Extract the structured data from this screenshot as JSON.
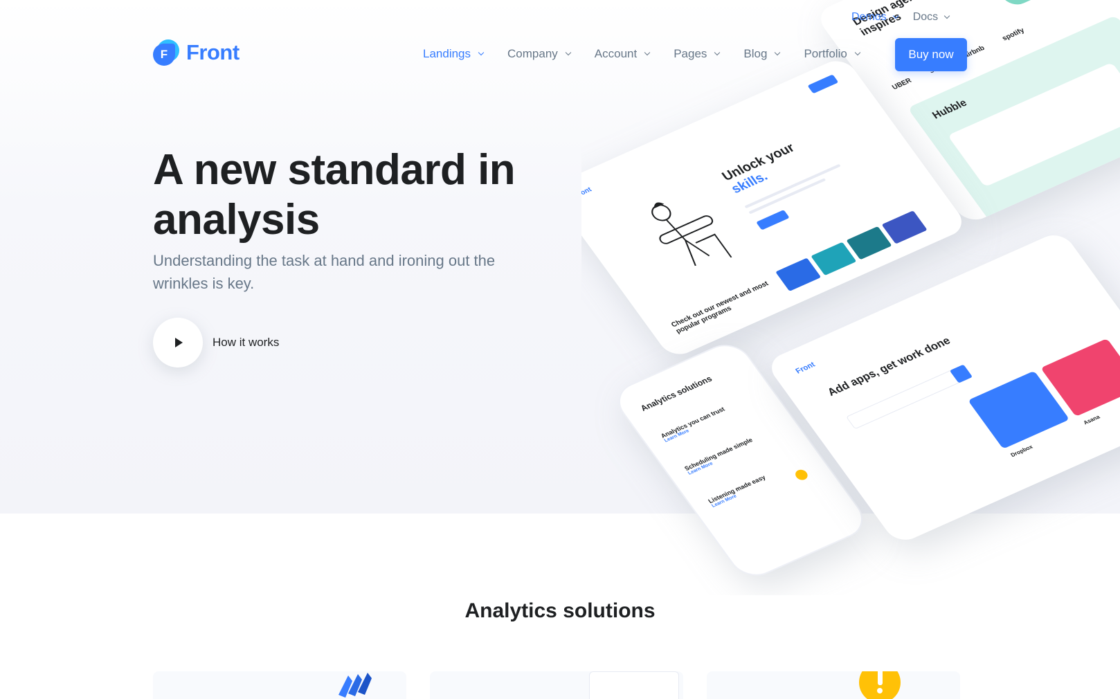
{
  "topbar": {
    "demos": "Demos",
    "docs": "Docs"
  },
  "brand": {
    "name": "Front",
    "letter": "F"
  },
  "nav": {
    "items": [
      "Landings",
      "Company",
      "Account",
      "Pages",
      "Blog",
      "Portfolio"
    ],
    "buy_label": "Buy now"
  },
  "hero": {
    "title": "A new standard in analysis",
    "subtitle": "Understanding the task at hand and ironing out the wrinkles is key.",
    "play_label": "How it works"
  },
  "mockups": {
    "tablet_headline": "Unlock your",
    "tablet_highlight": "skills.",
    "tablet_caption": "Check out our newest and most popular programs",
    "phone_title": "Analytics solutions",
    "phone_items": [
      "Analytics you can trust",
      "Scheduling made simple",
      "Listening made easy"
    ],
    "phone_link": "Learn More",
    "apps_headline": "Add apps, get work done",
    "apps_brand": "Front",
    "apps_cards": [
      "Dropbox",
      "Asana"
    ],
    "back_headline": "Design agency that inspires",
    "back_card": "Hubble",
    "back_logos": [
      "UBER",
      "slack",
      "airbnb",
      "spotify"
    ]
  },
  "section": {
    "title": "Analytics solutions"
  },
  "colors": {
    "primary": "#377dff",
    "text": "#1e2022",
    "muted": "#677788"
  }
}
